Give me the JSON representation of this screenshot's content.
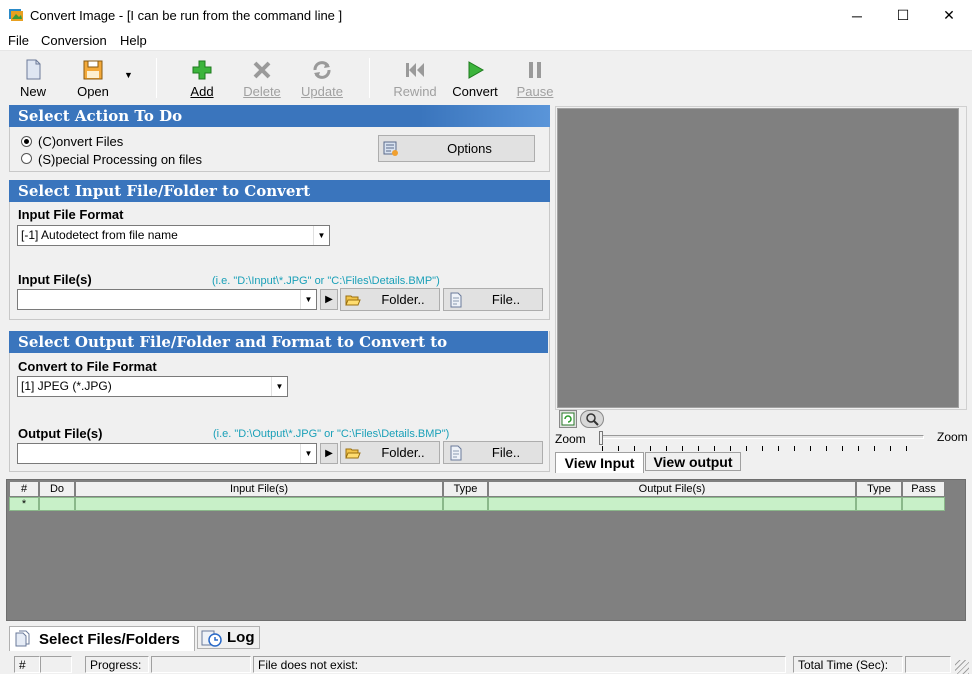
{
  "window": {
    "title": "Convert Image - [I can be run from the command line ]",
    "minimize": "─",
    "maximize": "☐",
    "close": "✕"
  },
  "menu": [
    "File",
    "Conversion",
    "Help"
  ],
  "toolbar": {
    "new": "New",
    "open": "Open",
    "add": "Add",
    "delete": "Delete",
    "update": "Update",
    "rewind": "Rewind",
    "convert": "Convert",
    "pause": "Pause"
  },
  "action_panel": {
    "title": "Select Action To Do",
    "convert_files": "(C)onvert Files",
    "special_processing": "(S)pecial Processing on files",
    "options_button": "Options"
  },
  "input_panel": {
    "title": "Select Input File/Folder to Convert",
    "format_label": "Input File Format",
    "format_value": "[-1] Autodetect from file name",
    "files_label": "Input File(s)",
    "hint": "(i.e. \"D:\\Input\\*.JPG\"  or  \"C:\\Files\\Details.BMP\")",
    "files_value": "",
    "folder_button": "Folder..",
    "file_button": "File.."
  },
  "output_panel": {
    "title": "Select Output File/Folder and Format to Convert to",
    "format_label": "Convert to File Format",
    "format_value": "[1] JPEG (*.JPG)",
    "files_label": "Output File(s)",
    "hint": "(i.e. \"D:\\Output\\*.JPG\"  or  \"C:\\Files\\Details.BMP\")",
    "files_value": "",
    "folder_button": "Folder..",
    "file_button": "File.."
  },
  "preview": {
    "zoom_left": "Zoom",
    "zoom_right": "Zoom",
    "view_input_tab": "View Input",
    "view_output_tab": "View output"
  },
  "grid": {
    "columns": [
      "#",
      "Do",
      "Input File(s)",
      "Type",
      "Output File(s)",
      "Type",
      "Pass"
    ],
    "new_row_marker": "*"
  },
  "bottom_tabs": {
    "select_files": "Select Files/Folders",
    "log": "Log"
  },
  "status": {
    "hash": "#",
    "progress": "Progress:",
    "message": "File does not exist:",
    "total_time": "Total Time (Sec):"
  },
  "colors": {
    "panel_header": "#3a75bd",
    "hint_text": "#1aa0b8",
    "grid_row": "#c8f0c8",
    "preview_bg": "#808080"
  }
}
